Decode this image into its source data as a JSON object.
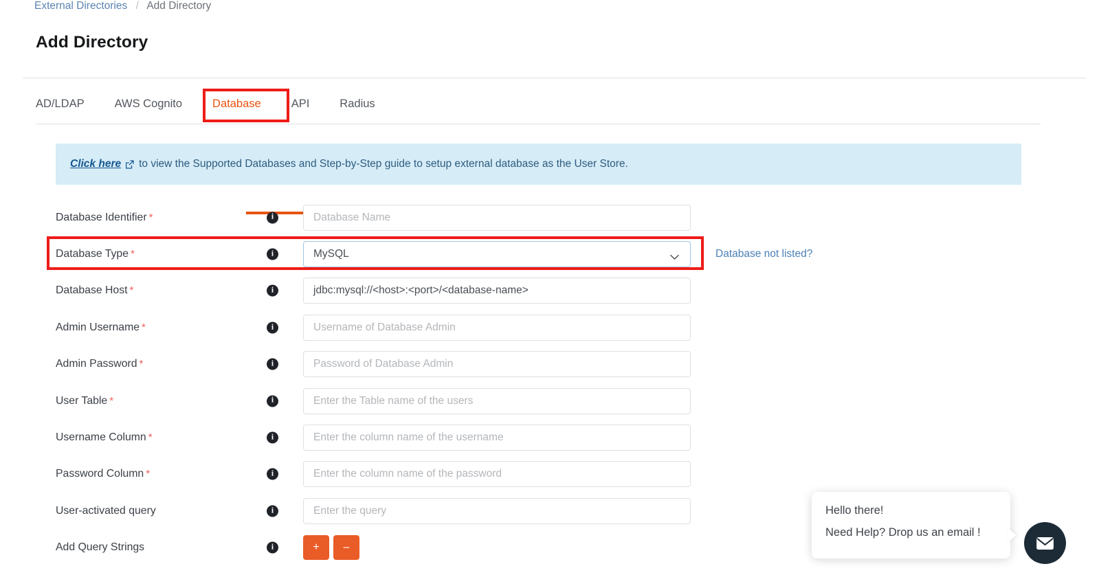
{
  "breadcrumb": {
    "parent": "External Directories",
    "separator": "/",
    "current": "Add Directory"
  },
  "page_title": "Add Directory",
  "tabs": [
    {
      "label": "AD/LDAP",
      "active": false
    },
    {
      "label": "AWS Cognito",
      "active": false
    },
    {
      "label": "Database",
      "active": true
    },
    {
      "label": "API",
      "active": false
    },
    {
      "label": "Radius",
      "active": false
    }
  ],
  "banner": {
    "link_text": "Click here",
    "icon": "external-link-icon",
    "text": "to view the Supported Databases and Step-by-Step guide to setup external database as the User Store."
  },
  "form": {
    "info_icon": "info-icon",
    "fields": [
      {
        "label": "Database Identifier",
        "required": true,
        "placeholder": "Database Name",
        "value": "",
        "type": "text"
      },
      {
        "label": "Database Type",
        "required": true,
        "placeholder": "",
        "value": "MySQL",
        "type": "select",
        "side_link": "Database not listed?"
      },
      {
        "label": "Database Host",
        "required": true,
        "placeholder": "",
        "value": "jdbc:mysql://<host>:<port>/<database-name>",
        "type": "text"
      },
      {
        "label": "Admin Username",
        "required": true,
        "placeholder": "Username of Database Admin",
        "value": "",
        "type": "text"
      },
      {
        "label": "Admin Password",
        "required": true,
        "placeholder": "Password of Database Admin",
        "value": "",
        "type": "password"
      },
      {
        "label": "User Table",
        "required": true,
        "placeholder": "Enter the Table name of the users",
        "value": "",
        "type": "text"
      },
      {
        "label": "Username Column",
        "required": true,
        "placeholder": "Enter the column name of the username",
        "value": "",
        "type": "text"
      },
      {
        "label": "Password Column",
        "required": true,
        "placeholder": "Enter the column name of the password",
        "value": "",
        "type": "text"
      },
      {
        "label": "User-activated query",
        "required": false,
        "placeholder": "Enter the query",
        "value": "",
        "type": "text"
      },
      {
        "label": "Add Query Strings",
        "required": false,
        "type": "buttons",
        "add_label": "+",
        "remove_label": "–"
      }
    ]
  },
  "chat": {
    "greeting": "Hello there!",
    "message": "Need Help? Drop us an email !",
    "button_icon": "envelope-icon"
  },
  "colors": {
    "accent_orange": "#e8540f",
    "button_orange": "#ea5c27",
    "annotation_red": "#ee1c18",
    "banner_bg": "#d6ecf7",
    "link_blue": "#4a7fb5",
    "chat_dark": "#1d2b36"
  }
}
